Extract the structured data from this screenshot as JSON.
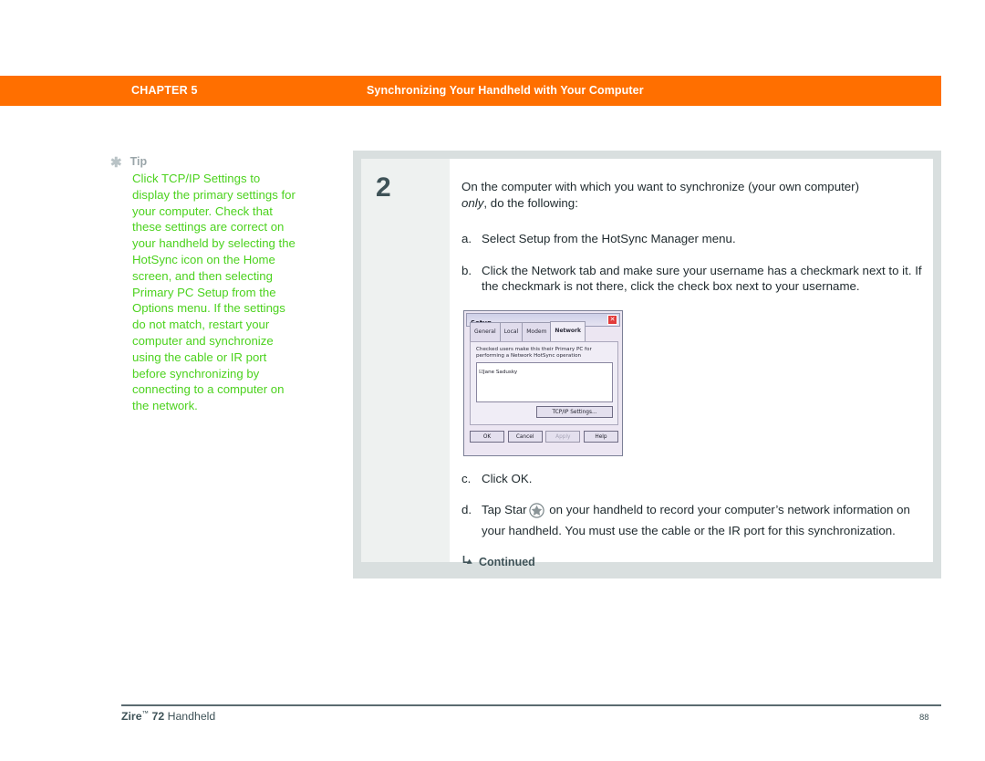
{
  "header": {
    "chapter": "CHAPTER 5",
    "title": "Synchronizing Your Handheld with Your Computer",
    "bar_color": "#ff6f00"
  },
  "tip": {
    "icon": "asterisk-icon",
    "label": "Tip",
    "body": "Click TCP/IP Settings to display the primary settings for your computer. Check that these settings are correct on your handheld by selecting the HotSync icon on the Home screen, and then selecting Primary PC Setup from the Options menu. If the settings do not match, restart your computer and synchronize using the cable or IR port before synchronizing by connecting to a computer on the network.",
    "text_color": "#4cd21e",
    "label_color": "#9aa5a9"
  },
  "step": {
    "number": "2",
    "intro_line1": "On the computer with which you want to synchronize (your own computer)",
    "intro_italic": "only",
    "intro_line2": ", do the following:",
    "items": [
      {
        "marker": "a.",
        "text": "Select Setup from the HotSync Manager menu."
      },
      {
        "marker": "b.",
        "text": "Click the Network tab and make sure your username has a checkmark next to it. If the checkmark is not there, click the check box next to your username."
      },
      {
        "marker": "c.",
        "text": "Click OK."
      }
    ],
    "item_d": {
      "marker": "d.",
      "text_before": "Tap Star",
      "icon": "star-in-circle-icon",
      "text_after": "on your handheld to record your computer’s network information on your handheld. You must use the cable or the IR port for this synchronization."
    },
    "continued": {
      "icon": "arrow-down-right-icon",
      "label": "Continued"
    }
  },
  "setup_dialog": {
    "title": "Setup",
    "close_icon": "close-icon",
    "tabs": [
      {
        "label": "General",
        "active": false
      },
      {
        "label": "Local",
        "active": false
      },
      {
        "label": "Modem",
        "active": false
      },
      {
        "label": "Network",
        "active": true
      }
    ],
    "description": "Checked users make this their Primary PC for performing a Network HotSync operation",
    "list_items": [
      {
        "checked": true,
        "label": "Jane Sadusky"
      }
    ],
    "tcpip_button": "TCP/IP Settings...",
    "buttons": [
      {
        "label": "OK",
        "disabled": false
      },
      {
        "label": "Cancel",
        "disabled": false
      },
      {
        "label": "Apply",
        "disabled": true
      },
      {
        "label": "Help",
        "disabled": false
      }
    ]
  },
  "footer": {
    "product": "Zire",
    "trademark": "™",
    "model": " 72",
    "suffix": " Handheld",
    "page": "88"
  }
}
